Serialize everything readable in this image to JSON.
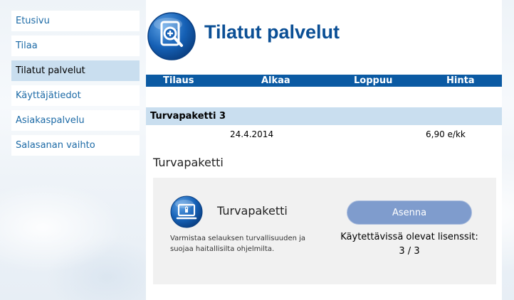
{
  "sidebar": {
    "items": [
      {
        "label": "Etusivu"
      },
      {
        "label": "Tilaa"
      },
      {
        "label": "Tilatut palvelut"
      },
      {
        "label": "Käyttäjätiedot"
      },
      {
        "label": "Asiakaspalvelu"
      },
      {
        "label": "Salasanan vaihto"
      }
    ],
    "active_index": 2
  },
  "page": {
    "title": "Tilatut palvelut",
    "icon": "magnify-plus-icon"
  },
  "table": {
    "headers": [
      "Tilaus",
      "Alkaa",
      "Loppuu",
      "Hinta"
    ],
    "order": {
      "name": "Turvapaketti 3",
      "start": "24.4.2014",
      "end": "",
      "price": "6,90 e/kk"
    }
  },
  "section": {
    "title": "Turvapaketti"
  },
  "product": {
    "name": "Turvapaketti",
    "icon": "monitor-lock-icon",
    "description": "Varmistaa selauksen turvallisuuden ja suojaa haitallisilta ohjelmilta.",
    "install_label": "Asenna",
    "license_text": "Käytettävissä olevat lisenssit: 3 / 3"
  },
  "colors": {
    "brand": "#0b4f95",
    "header_bar": "#0b5aa3",
    "highlight": "#c9deef",
    "button": "#7f9ccd"
  }
}
